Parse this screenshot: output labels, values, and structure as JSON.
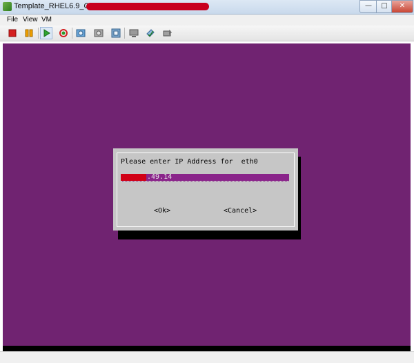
{
  "window": {
    "title": "Template_RHEL6.9_OS_x64",
    "min_glyph": "—",
    "max_glyph": "□",
    "close_glyph": "✕"
  },
  "menu": {
    "items": [
      "File",
      "View",
      "VM"
    ]
  },
  "toolbar": {
    "icons": [
      "stop-icon",
      "pause-icon",
      "play-icon",
      "reset-icon",
      "snapshot-icon",
      "revert-snapshot-icon",
      "manage-snapshots-icon",
      "console-icon",
      "settings-icon",
      "send-keys-icon"
    ]
  },
  "dialog": {
    "prompt": "Please enter IP Address for  eth0",
    "ip_value": ".49.14",
    "ok_label": "<Ok>",
    "cancel_label": "<Cancel>"
  },
  "colors": {
    "console_background": "#702371",
    "dialog_background": "#c6c6c6",
    "input_background": "#8a248a"
  }
}
